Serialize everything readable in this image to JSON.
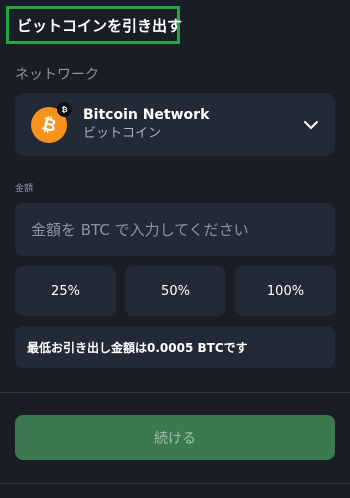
{
  "header": {
    "title": "ビットコインを引き出す"
  },
  "network": {
    "label": "ネットワーク",
    "name": "Bitcoin Network",
    "sub": "ビットコイン",
    "icon": "bitcoin-icon",
    "badge_icon": "bitcoin-badge-icon",
    "chevron_icon": "chevron-down-icon",
    "coin_color": "#f7931a"
  },
  "amount": {
    "label": "金額",
    "placeholder": "金額を BTC で入力してください",
    "value": ""
  },
  "percent_buttons": [
    "25%",
    "50%",
    "100%"
  ],
  "min_withdrawal": {
    "text": "最低お引き出し金額は0.0005 BTCです"
  },
  "continue": {
    "label": "続ける",
    "color": "#3b7a4f"
  },
  "highlight_color": "#22a53e"
}
